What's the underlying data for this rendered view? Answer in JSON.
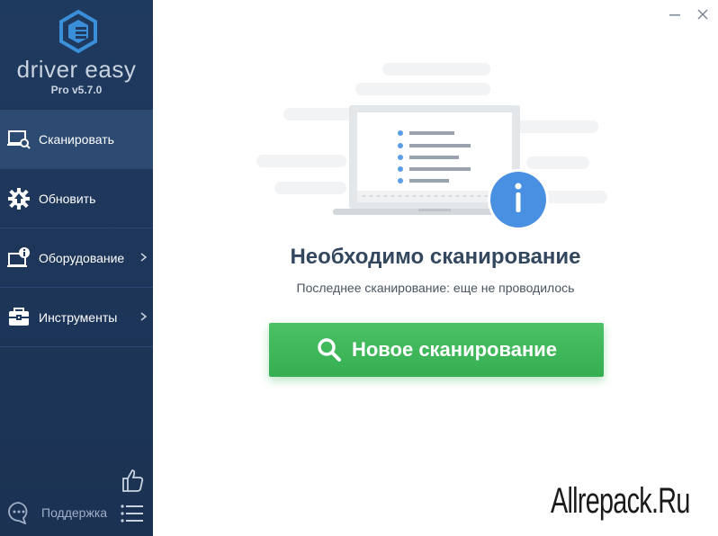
{
  "app": {
    "brand": "driver easy",
    "version": "Pro v5.7.0"
  },
  "sidebar": {
    "items": [
      {
        "label": "Сканировать",
        "icon": "laptop-search-icon",
        "active": true,
        "has_submenu": false
      },
      {
        "label": "Обновить",
        "icon": "gear-update-icon",
        "active": false,
        "has_submenu": false
      },
      {
        "label": "Оборудование",
        "icon": "hardware-info-icon",
        "active": false,
        "has_submenu": true
      },
      {
        "label": "Инструменты",
        "icon": "toolbox-icon",
        "active": false,
        "has_submenu": true
      }
    ],
    "support_label": "Поддержка"
  },
  "main": {
    "headline": "Необходимо сканирование",
    "subtext": "Последнее сканирование: еще не проводилось",
    "scan_button_label": "Новое сканирование"
  },
  "watermark": "Allrepack.Ru",
  "colors": {
    "sidebar_bg": "#1f3a5f",
    "active_item": "#2c4a72",
    "accent_green": "#3db559",
    "info_blue": "#4a90e2",
    "headline": "#33485f"
  }
}
